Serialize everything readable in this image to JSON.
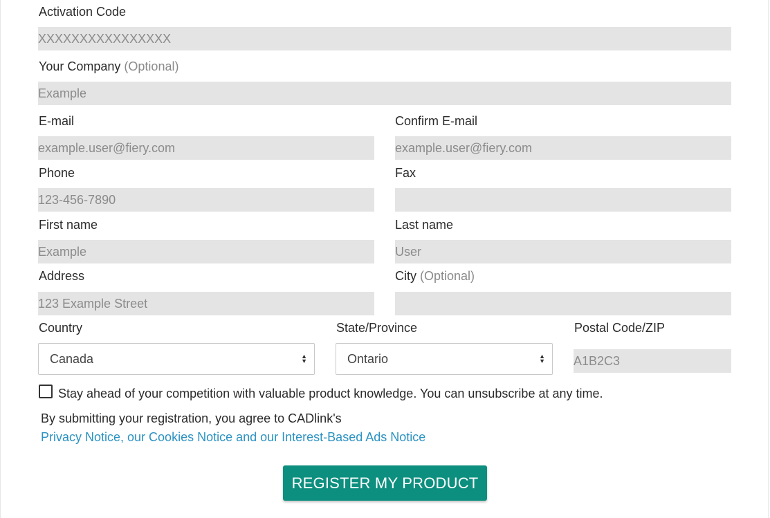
{
  "form": {
    "activation_code": {
      "label": "Activation Code",
      "placeholder": "XXXXXXXXXXXXXXXX"
    },
    "company": {
      "label": "Your Company",
      "optional": "(Optional)",
      "placeholder": "Example"
    },
    "email": {
      "label": "E-mail",
      "placeholder": "example.user@fiery.com"
    },
    "confirm_email": {
      "label": "Confirm E-mail",
      "placeholder": "example.user@fiery.com"
    },
    "phone": {
      "label": "Phone",
      "placeholder": "123-456-7890"
    },
    "fax": {
      "label": "Fax",
      "placeholder": ""
    },
    "first_name": {
      "label": "First name",
      "placeholder": "Example"
    },
    "last_name": {
      "label": "Last name",
      "placeholder": "User"
    },
    "address": {
      "label": "Address",
      "placeholder": "123 Example Street"
    },
    "city": {
      "label": "City",
      "optional": "(Optional)",
      "placeholder": ""
    },
    "country": {
      "label": "Country",
      "value": "Canada"
    },
    "state": {
      "label": "State/Province",
      "value": "Ontario"
    },
    "postal": {
      "label": "Postal Code/ZIP",
      "placeholder": "A1B2C3"
    },
    "newsletter": {
      "label": "Stay ahead of your competition with valuable product knowledge. You can unsubscribe at any time.",
      "checked": false
    },
    "agreement": {
      "text": "By submitting your registration, you agree to CADlink's",
      "link_text": "Privacy Notice, our Cookies Notice and our Interest-Based Ads Notice"
    },
    "submit_label": "REGISTER MY PRODUCT"
  },
  "colors": {
    "field_bg": "#e4e4e4",
    "button_bg": "#0d8f7f",
    "link": "#2b92c2",
    "placeholder": "#8b8b8b"
  },
  "icons": {
    "select_arrow": "updown-chevron-icon"
  }
}
